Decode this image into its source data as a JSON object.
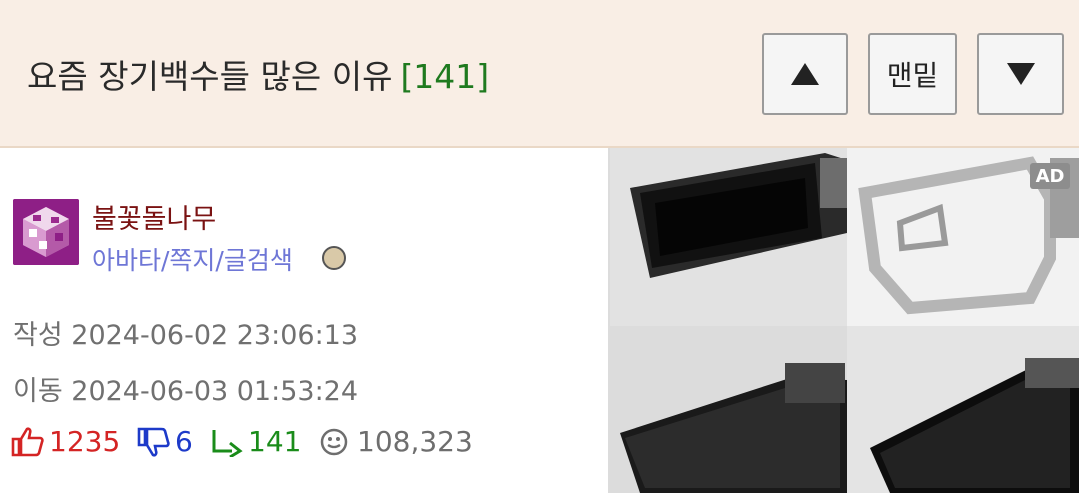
{
  "header": {
    "title": "요즘 장기백수들 많은 이유",
    "reply_count": "[141]",
    "up_button": "▲",
    "bottom_button": "맨밑",
    "down_button": "▼"
  },
  "author": {
    "nickname": "불꽃돌나무",
    "links": "아바타/쪽지/글검색"
  },
  "meta": {
    "created": "작성 2024-06-02 23:06:13",
    "moved": "이동 2024-06-03 01:53:24"
  },
  "stats": {
    "upvotes": "1235",
    "downvotes": "6",
    "replies": "141",
    "views": "108,323"
  },
  "ad": {
    "tag": "AD"
  },
  "colors": {
    "header_bg": "#f9eee5",
    "title_count": "#1f7a1f",
    "nickname": "#7a1212",
    "links": "#6e76d6",
    "upvote": "#d42424",
    "downvote": "#1d3ac9",
    "reply": "#1a8c1a"
  },
  "icons": [
    "thumbs-up-icon",
    "thumbs-down-icon",
    "reply-arrow-icon",
    "views-smiley-icon",
    "rank-badge-icon"
  ]
}
